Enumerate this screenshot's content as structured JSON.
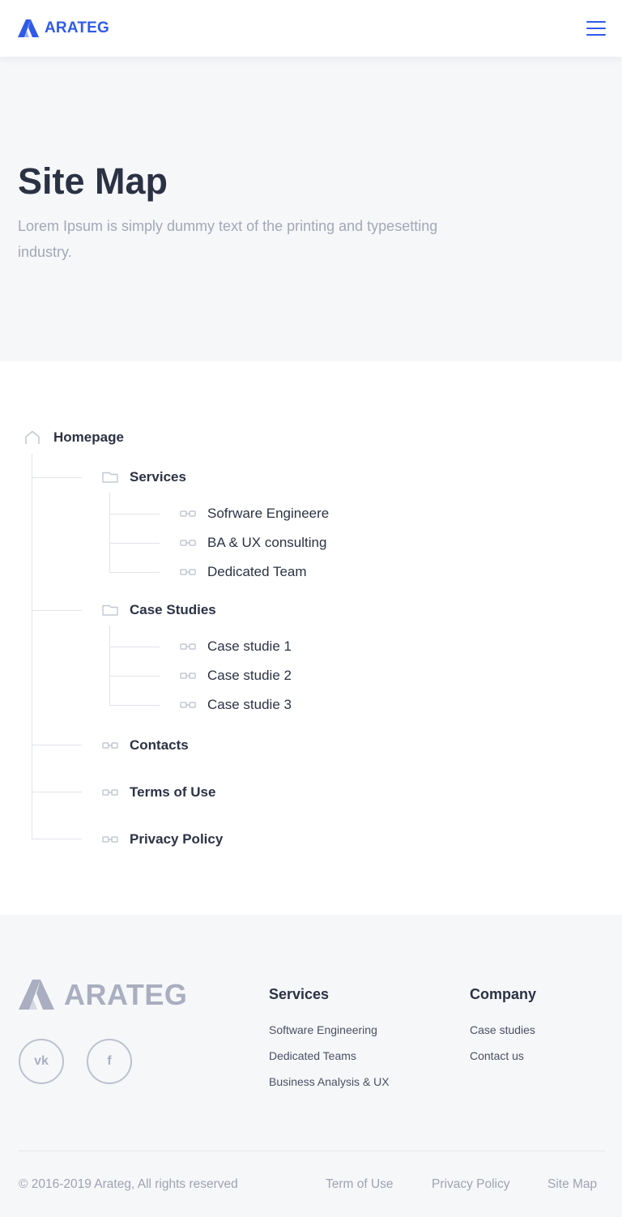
{
  "header": {
    "logo_text": "ARATEG",
    "menu_icon": "hamburger-menu-icon"
  },
  "hero": {
    "title": "Site Map",
    "description": "Lorem Ipsum is simply dummy text of the printing and typesetting industry."
  },
  "sitemap": {
    "root": {
      "label": "Homepage",
      "icon": "home-icon"
    },
    "services": {
      "label": "Services",
      "icon": "folder-icon",
      "children": [
        {
          "label": "Sofrware Engineere",
          "icon": "link-icon"
        },
        {
          "label": "BA & UX consulting",
          "icon": "link-icon"
        },
        {
          "label": "Dedicated Team",
          "icon": "link-icon"
        }
      ]
    },
    "case_studies": {
      "label": "Case Studies",
      "icon": "folder-icon",
      "children": [
        {
          "label": "Case studie 1",
          "icon": "link-icon"
        },
        {
          "label": "Case studie 2",
          "icon": "link-icon"
        },
        {
          "label": "Case studie 3",
          "icon": "link-icon"
        }
      ]
    },
    "contacts": {
      "label": "Contacts",
      "icon": "link-icon"
    },
    "terms": {
      "label": "Terms of Use",
      "icon": "link-icon"
    },
    "privacy": {
      "label": "Privacy Policy",
      "icon": "link-icon"
    }
  },
  "footer": {
    "logo_text": "ARATEG",
    "social": [
      {
        "name": "vk-icon",
        "glyph": "vk"
      },
      {
        "name": "facebook-icon",
        "glyph": "f"
      }
    ],
    "services": {
      "heading": "Services",
      "links": [
        "Software Engineering",
        "Dedicated Teams",
        "Business Analysis & UX"
      ]
    },
    "company": {
      "heading": "Company",
      "links": [
        "Case studies",
        "Contact us"
      ]
    },
    "copyright": "© 2016-2019 Arateg, All rights reserved",
    "bottom_links": [
      "Term of Use",
      "Privacy Policy",
      "Site Map"
    ]
  },
  "colors": {
    "brand": "#2f5bea",
    "text_dark": "#2b3244",
    "text_muted": "#a3a8b6",
    "light_bg": "#f6f7f9"
  }
}
